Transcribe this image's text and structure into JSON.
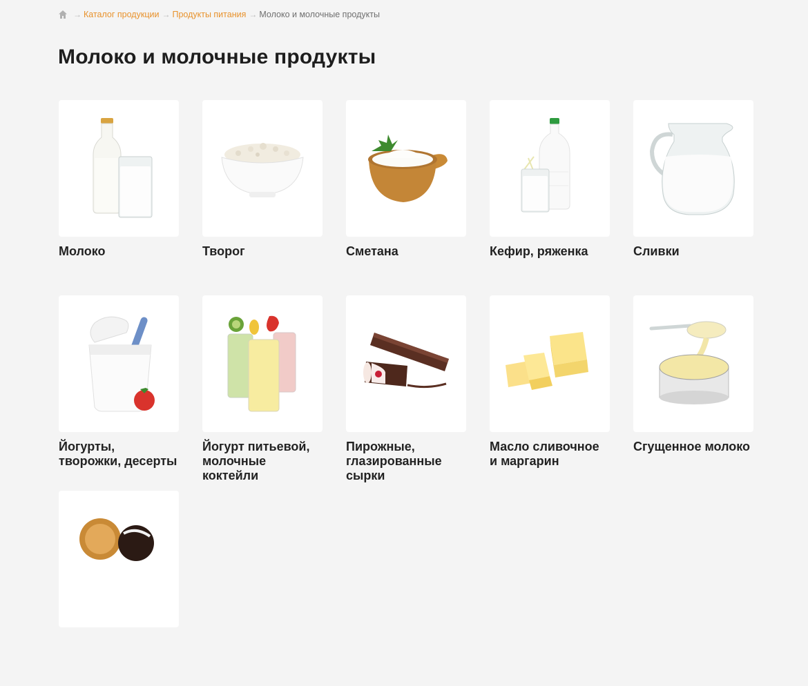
{
  "breadcrumb": {
    "items": [
      {
        "label": "Каталог продукции"
      },
      {
        "label": "Продукты питания"
      }
    ],
    "current": "Молоко и молочные продукты"
  },
  "page": {
    "title": "Молоко и молочные продукты"
  },
  "categories": [
    {
      "title": "Молоко",
      "icon": "milk-bottle-glass-icon"
    },
    {
      "title": "Творог",
      "icon": "cottage-cheese-bowl-icon"
    },
    {
      "title": "Сметана",
      "icon": "sour-cream-pot-icon"
    },
    {
      "title": "Кефир, ряженка",
      "icon": "kefir-bottle-icon"
    },
    {
      "title": "Сливки",
      "icon": "cream-jug-icon"
    },
    {
      "title": "Йогурты, творожки, десерты",
      "icon": "yogurt-cup-icon"
    },
    {
      "title": "Йогурт питьевой, молочные коктейли",
      "icon": "milkshake-glasses-icon"
    },
    {
      "title": "Пирожные, глазированные сырки",
      "icon": "glazed-curd-bars-icon"
    },
    {
      "title": "Масло сливочное и маргарин",
      "icon": "butter-icon"
    },
    {
      "title": "Сгущенное молоко",
      "icon": "condensed-milk-icon"
    },
    {
      "title": "",
      "icon": "ice-cream-icon"
    }
  ],
  "colors": {
    "accent": "#e8922c",
    "background": "#f4f4f4",
    "card": "#ffffff"
  }
}
